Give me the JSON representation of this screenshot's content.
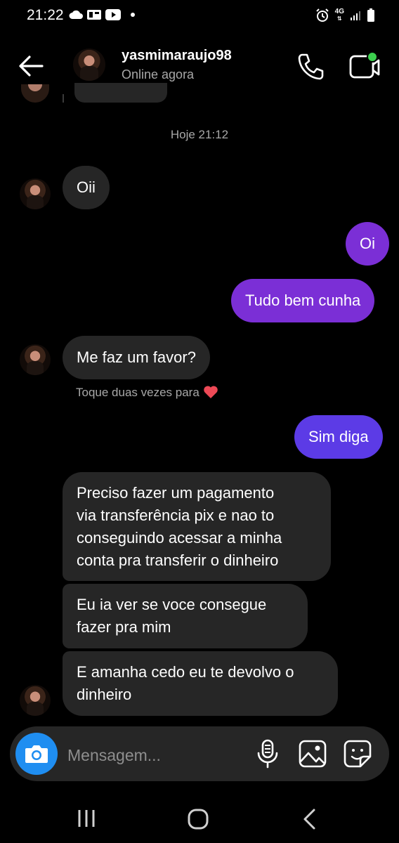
{
  "status_bar": {
    "time": "21:22",
    "left_icons": [
      "cloud-icon",
      "link-app-icon",
      "youtube-icon",
      "dot-icon"
    ],
    "right_icons": [
      "alarm-icon",
      "network-4g-icon",
      "signal-icon",
      "battery-icon"
    ],
    "network_label": "4G"
  },
  "header": {
    "username": "yasmimaraujo98",
    "status": "Online agora",
    "icons": [
      "back-arrow-icon",
      "phone-icon",
      "video-call-icon"
    ],
    "video_active_dot_color": "#3ccf4e"
  },
  "chat": {
    "date_separator": "Hoje 21:12",
    "hint": "Toque duas vezes para",
    "hint_icon": "heart-icon",
    "messages": [
      {
        "from": "them",
        "text": "Oii"
      },
      {
        "from": "me",
        "text": "Oi"
      },
      {
        "from": "me",
        "text": "Tudo bem cunha"
      },
      {
        "from": "them",
        "text": "Me faz um favor?"
      },
      {
        "from": "me",
        "text": "Sim diga"
      },
      {
        "from": "them",
        "lines": [
          "Preciso fazer um pagamento",
          "via transferência pix e nao to",
          "conseguindo acessar a minha",
          "conta pra transferir o dinheiro"
        ]
      },
      {
        "from": "them",
        "lines": [
          "Eu ia ver se voce consegue",
          "fazer pra mim"
        ]
      },
      {
        "from": "them",
        "lines": [
          "E amanha cedo eu te devolvo o",
          "dinheiro"
        ]
      }
    ]
  },
  "composer": {
    "placeholder": "Mensagem...",
    "icons": [
      "camera-icon",
      "microphone-icon",
      "gallery-icon",
      "sticker-icon"
    ]
  },
  "nav_bar": {
    "icons": [
      "recent-apps-icon",
      "home-icon",
      "back-icon"
    ]
  },
  "colors": {
    "background": "#000000",
    "incoming_bubble": "#262626",
    "outgoing_bubble_purple": "#7b2fd6",
    "outgoing_bubble_violet": "#5c3be6",
    "camera_button": "#1f8ef1",
    "heart": "#ed4956"
  }
}
